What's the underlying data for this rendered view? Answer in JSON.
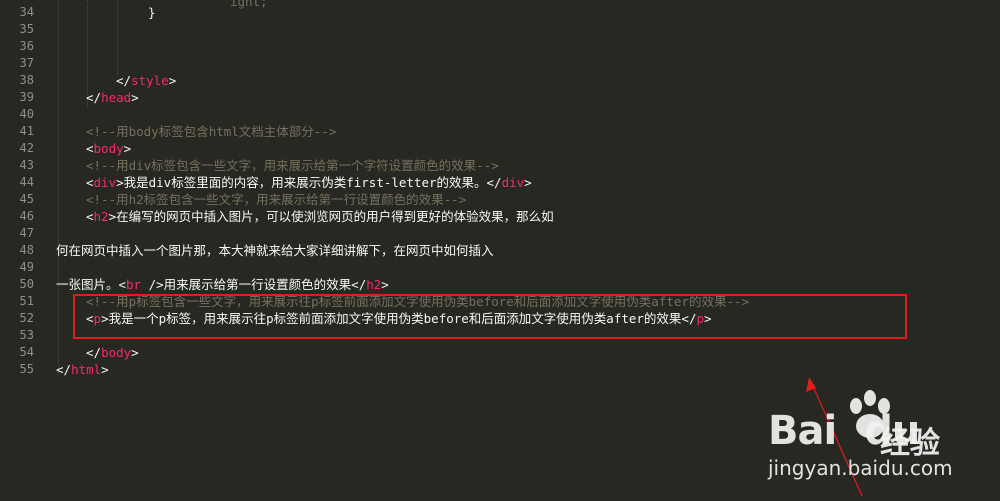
{
  "lines": [
    {
      "n": "34",
      "parts": [
        {
          "t": "}",
          "c": "txt"
        }
      ],
      "indent": 148
    },
    {
      "n": "35",
      "parts": [],
      "indent": 56
    },
    {
      "n": "36",
      "parts": [],
      "indent": 56
    },
    {
      "n": "37",
      "parts": [],
      "indent": 56
    },
    {
      "n": "38",
      "parts": [
        {
          "t": "</",
          "c": "punc"
        },
        {
          "t": "style",
          "c": "tag"
        },
        {
          "t": ">",
          "c": "punc"
        }
      ],
      "indent": 116
    },
    {
      "n": "39",
      "parts": [
        {
          "t": "</",
          "c": "punc"
        },
        {
          "t": "head",
          "c": "tag"
        },
        {
          "t": ">",
          "c": "punc"
        }
      ],
      "indent": 86
    },
    {
      "n": "40",
      "parts": [],
      "indent": 56
    },
    {
      "n": "41",
      "parts": [
        {
          "t": "<!--用body标签包含html文档主体部分-->",
          "c": "cmt"
        }
      ],
      "indent": 86
    },
    {
      "n": "42",
      "parts": [
        {
          "t": "<",
          "c": "punc"
        },
        {
          "t": "body",
          "c": "tag"
        },
        {
          "t": ">",
          "c": "punc"
        }
      ],
      "indent": 86
    },
    {
      "n": "43",
      "parts": [
        {
          "t": "<!--用div标签包含一些文字，用来展示给第一个字符设置颜色的效果-->",
          "c": "cmt"
        }
      ],
      "indent": 86
    },
    {
      "n": "44",
      "parts": [
        {
          "t": "<",
          "c": "punc"
        },
        {
          "t": "div",
          "c": "tag"
        },
        {
          "t": ">我是div标签里面的内容，用来展示伪类first-letter的效果。</",
          "c": "txt"
        },
        {
          "t": "div",
          "c": "tag"
        },
        {
          "t": ">",
          "c": "punc"
        }
      ],
      "indent": 86
    },
    {
      "n": "45",
      "parts": [
        {
          "t": "<!--用h2标签包含一些文字，用来展示给第一行设置颜色的效果-->",
          "c": "cmt"
        }
      ],
      "indent": 86
    },
    {
      "n": "46",
      "parts": [
        {
          "t": "<",
          "c": "punc"
        },
        {
          "t": "h2",
          "c": "tag"
        },
        {
          "t": ">在编写的网页中插入图片，可以使浏览网页的用户得到更好的体验效果，那么如",
          "c": "txt"
        }
      ],
      "indent": 86
    },
    {
      "n": "47",
      "parts": [],
      "indent": 56
    },
    {
      "n": "48",
      "parts": [
        {
          "t": "何在网页中插入一个图片那，本大神就来给大家详细讲解下，在网页中如何插入",
          "c": "txt"
        }
      ],
      "indent": 56
    },
    {
      "n": "49",
      "parts": [],
      "indent": 56
    },
    {
      "n": "50",
      "parts": [
        {
          "t": "一张图片。<",
          "c": "txt"
        },
        {
          "t": "br",
          "c": "tag"
        },
        {
          "t": " />用来展示给第一行设置颜色的效果</",
          "c": "txt"
        },
        {
          "t": "h2",
          "c": "tag"
        },
        {
          "t": ">",
          "c": "punc"
        }
      ],
      "indent": 56
    },
    {
      "n": "51",
      "parts": [
        {
          "t": "<!--用p标签包含一些文字，用来展示往p标签前面添加文字使用伪类before和后面添加文字使用伪类after的效果-->",
          "c": "cmt"
        }
      ],
      "indent": 86
    },
    {
      "n": "52",
      "parts": [
        {
          "t": "<",
          "c": "punc"
        },
        {
          "t": "p",
          "c": "tag"
        },
        {
          "t": ">我是一个p标签，用来展示往p标签前面添加文字使用伪类before和后面添加文字使用伪类after的效果</",
          "c": "txt"
        },
        {
          "t": "p",
          "c": "tag"
        },
        {
          "t": ">",
          "c": "punc"
        }
      ],
      "indent": 86
    },
    {
      "n": "53",
      "parts": [],
      "indent": 56
    },
    {
      "n": "54",
      "parts": [
        {
          "t": "</",
          "c": "punc"
        },
        {
          "t": "body",
          "c": "tag"
        },
        {
          "t": ">",
          "c": "punc"
        }
      ],
      "indent": 86
    },
    {
      "n": "55",
      "parts": [
        {
          "t": "</",
          "c": "punc"
        },
        {
          "t": "html",
          "c": "tag"
        },
        {
          "t": ">",
          "c": "punc"
        }
      ],
      "indent": 56
    }
  ],
  "top_line_fragment": "ight;",
  "watermark": {
    "logo_text": "Bai",
    "logo_text2": "du",
    "brand_cn": "经验",
    "url": "jingyan.baidu.com"
  },
  "colors": {
    "background": "#272822",
    "tag": "#f92672",
    "comment": "#75715e",
    "text": "#f8f8f2",
    "highlight_box": "#e21d1d"
  }
}
